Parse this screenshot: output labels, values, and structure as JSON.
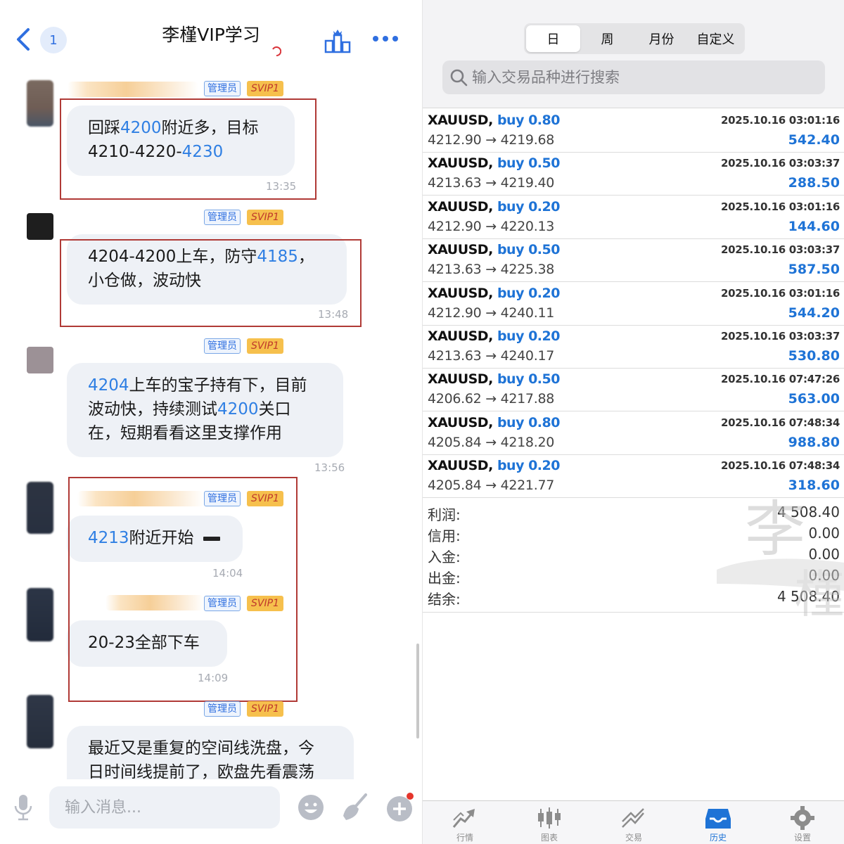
{
  "chat": {
    "title": "李槿VIP学习",
    "unread": "1",
    "input_placeholder": "输入消息...",
    "messages": [
      {
        "role": "管理员",
        "level": "SVIP1",
        "text": [
          "回踩",
          "4200",
          "附近多，目标",
          "4210-4220-",
          "4230"
        ],
        "time": "13:35"
      },
      {
        "role": "管理员",
        "level": "SVIP1",
        "text": [
          "4204-4200上车，防守",
          "4185",
          "，",
          "小仓做，波动快"
        ],
        "time": "13:48"
      },
      {
        "role": "管理员",
        "level": "SVIP1",
        "text": [
          "4204",
          "上车的宝子持有下，目前",
          "波动快，持续测试",
          "4200",
          "关口",
          "在，短期看看这里支撑作用"
        ],
        "time": "13:56"
      },
      {
        "role": "管理员",
        "level": "SVIP1",
        "text": [
          "4213",
          "附近开始"
        ],
        "time": "14:04"
      },
      {
        "role": "管理员",
        "level": "SVIP1",
        "text": [
          "20-23全部下车"
        ],
        "time": "14:09"
      },
      {
        "role": "管理员",
        "level": "SVIP1",
        "text": [
          "最近又是重复的空间线洗盘，今",
          "日时间线提前了，欧盘先看震荡"
        ]
      }
    ]
  },
  "trade": {
    "tabs": [
      "日",
      "周",
      "月份",
      "自定义"
    ],
    "active_tab": "日",
    "search_placeholder": "输入交易品种进行搜索",
    "deals": [
      {
        "symbol": "XAUUSD,",
        "side": "buy 0.80",
        "time": "2025.10.16 03:01:16",
        "prices": "4212.90 → 4219.68",
        "profit": "542.40"
      },
      {
        "symbol": "XAUUSD,",
        "side": "buy 0.50",
        "time": "2025.10.16 03:03:37",
        "prices": "4213.63 → 4219.40",
        "profit": "288.50"
      },
      {
        "symbol": "XAUUSD,",
        "side": "buy 0.20",
        "time": "2025.10.16 03:01:16",
        "prices": "4212.90 → 4220.13",
        "profit": "144.60"
      },
      {
        "symbol": "XAUUSD,",
        "side": "buy 0.50",
        "time": "2025.10.16 03:03:37",
        "prices": "4213.63 → 4225.38",
        "profit": "587.50"
      },
      {
        "symbol": "XAUUSD,",
        "side": "buy 0.20",
        "time": "2025.10.16 03:01:16",
        "prices": "4212.90 → 4240.11",
        "profit": "544.20"
      },
      {
        "symbol": "XAUUSD,",
        "side": "buy 0.20",
        "time": "2025.10.16 03:03:37",
        "prices": "4213.63 → 4240.17",
        "profit": "530.80"
      },
      {
        "symbol": "XAUUSD,",
        "side": "buy 0.50",
        "time": "2025.10.16 07:47:26",
        "prices": "4206.62 → 4217.88",
        "profit": "563.00"
      },
      {
        "symbol": "XAUUSD,",
        "side": "buy 0.80",
        "time": "2025.10.16 07:48:34",
        "prices": "4205.84 → 4218.20",
        "profit": "988.80"
      },
      {
        "symbol": "XAUUSD,",
        "side": "buy 0.20",
        "time": "2025.10.16 07:48:34",
        "prices": "4205.84 → 4221.77",
        "profit": "318.60"
      }
    ],
    "summary": [
      {
        "label": "利润:",
        "value": "4 508.40"
      },
      {
        "label": "信用:",
        "value": "0.00"
      },
      {
        "label": "入金:",
        "value": "0.00"
      },
      {
        "label": "出金:",
        "value": "0.00"
      },
      {
        "label": "结余:",
        "value": "4 508.40"
      }
    ],
    "bottom_tabs": [
      {
        "label": "行情",
        "icon": "quotes-icon"
      },
      {
        "label": "图表",
        "icon": "chart-icon"
      },
      {
        "label": "交易",
        "icon": "trade-icon"
      },
      {
        "label": "历史",
        "icon": "history-icon"
      },
      {
        "label": "设置",
        "icon": "settings-icon"
      }
    ],
    "active_bottom_tab": "历史",
    "colors": {
      "accent": "#1e73d6",
      "red_box": "#b03a36",
      "svip": "#f6c04d"
    }
  }
}
